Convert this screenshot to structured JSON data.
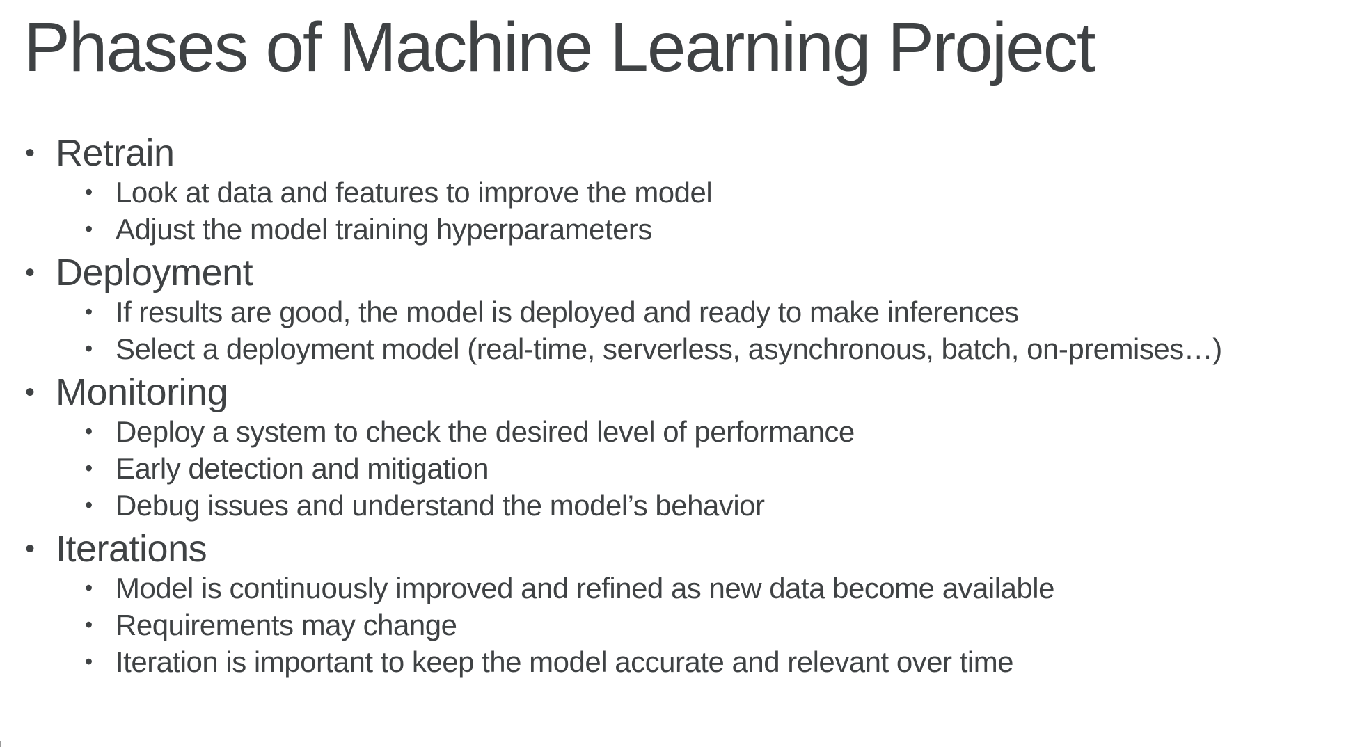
{
  "title": "Phases of Machine Learning Project",
  "bullet_glyph": "•",
  "sections": [
    {
      "heading": "Retrain",
      "items": [
        "Look at data and features to improve the model",
        "Adjust the model training hyperparameters"
      ]
    },
    {
      "heading": "Deployment",
      "items": [
        "If results are good, the model is deployed and ready to make inferences",
        "Select a deployment model (real-time, serverless, asynchronous, batch, on-premises…)"
      ]
    },
    {
      "heading": "Monitoring",
      "items": [
        "Deploy a system to check the desired level of performance",
        "Early detection and mitigation",
        "Debug issues and understand the model’s behavior"
      ]
    },
    {
      "heading": "Iterations",
      "items": [
        "Model is continuously improved and refined as new data become available",
        "Requirements may change",
        "Iteration is important to keep the model accurate and relevant over time"
      ]
    }
  ]
}
